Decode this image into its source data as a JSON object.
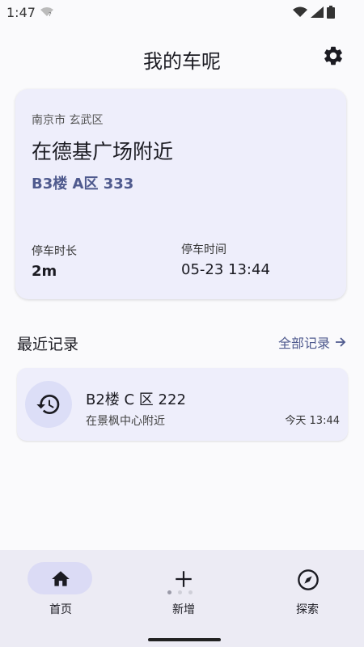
{
  "status": {
    "time": "1:47"
  },
  "header": {
    "title": "我的车呢"
  },
  "current": {
    "city": "南京市 玄武区",
    "place": "在德基广场附近",
    "spot": "B3楼 A区 333",
    "duration_label": "停车时长",
    "duration_value": "2m",
    "parktime_label": "停车时间",
    "parktime_value": "05-23 13:44"
  },
  "recent": {
    "title": "最近记录",
    "all_label": "全部记录",
    "items": [
      {
        "spot": "B2楼 C 区 222",
        "place": "在景枫中心附近",
        "time": "今天 13:44"
      }
    ]
  },
  "nav": {
    "items": [
      {
        "label": "首页",
        "icon": "home-icon",
        "selected": true
      },
      {
        "label": "新增",
        "icon": "add-icon"
      },
      {
        "label": "探索",
        "icon": "compass-icon"
      }
    ]
  },
  "colors": {
    "accent": "#4f5a8e",
    "card": "#eeeefb",
    "nav_bg": "#ecebf4",
    "pill": "#dbdbf5"
  }
}
